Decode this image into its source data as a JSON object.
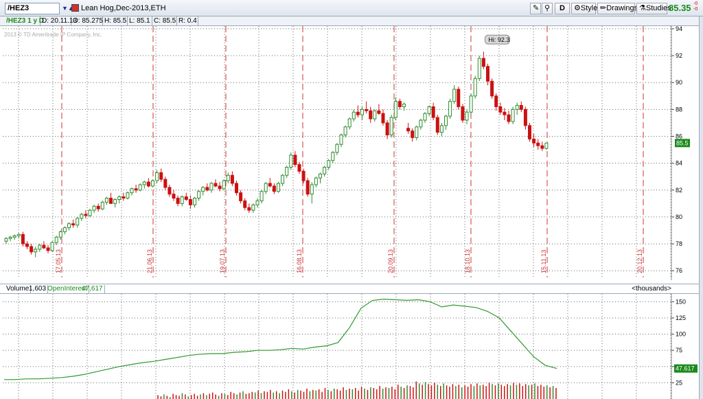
{
  "toolbar": {
    "symbol": "/HEZ3",
    "symbol_arrows": "▼▲",
    "description": "Lean Hog,Dec-2013,ETH",
    "aggregation": "D",
    "style_label": "Style",
    "drawings_label": "Drawings",
    "studies_label": "Studies",
    "last_price": "85.35",
    "net_change_top": "-0",
    "net_change_bottom": "-0"
  },
  "infobar": {
    "study": "/HEZ3 1 y D",
    "date": "D: 20.11.13",
    "open": "O: 85.275",
    "high": "H: 85.5",
    "low": "L: 85.1",
    "close": "C: 85.5",
    "range": "R: 0.4"
  },
  "price_pane": {
    "copyright": "2013 © TD Ameritrade IP Company, Inc.",
    "hi_label": "Hi: 92.3",
    "last_badge": "85.5",
    "colors": {
      "up": "#2e8b2e",
      "down": "#cc1111",
      "grid": "#666666",
      "marker": "#cc3333"
    }
  },
  "volume_header": {
    "volume_label": "Volume",
    "volume_value": "1,603",
    "oi_label": "OpenInterest",
    "oi_value": "47,617",
    "units": "<thousands>"
  },
  "volume_pane": {
    "oi_badge": "47.617"
  },
  "chart_data": {
    "type": "candlestick",
    "price_axis": {
      "ticks": [
        76,
        78,
        80,
        82,
        84,
        86,
        88,
        90,
        92,
        94
      ],
      "ylim": [
        75.5,
        94.2
      ]
    },
    "date_markers": [
      "17.05.13",
      "21.06.13",
      "19.07.13",
      "16.08.13",
      "20.09.13",
      "18.10.13",
      "15.11.13",
      "20.12.13"
    ],
    "ohlc": [
      [
        78.2,
        78.5,
        78.0,
        78.4
      ],
      [
        78.4,
        78.6,
        78.2,
        78.5
      ],
      [
        78.5,
        78.7,
        78.3,
        78.6
      ],
      [
        78.6,
        78.8,
        78.4,
        78.7
      ],
      [
        78.7,
        78.9,
        77.8,
        78.0
      ],
      [
        78.0,
        78.2,
        77.6,
        77.8
      ],
      [
        77.8,
        78.0,
        77.2,
        77.4
      ],
      [
        77.4,
        77.8,
        77.0,
        77.6
      ],
      [
        77.6,
        78.0,
        77.4,
        77.9
      ],
      [
        77.9,
        78.2,
        77.6,
        77.7
      ],
      [
        77.7,
        77.9,
        77.3,
        77.5
      ],
      [
        77.5,
        78.2,
        77.4,
        78.1
      ],
      [
        78.1,
        78.6,
        77.9,
        78.5
      ],
      [
        78.5,
        79.0,
        78.3,
        78.9
      ],
      [
        78.9,
        79.3,
        78.7,
        79.2
      ],
      [
        79.2,
        79.6,
        79.0,
        79.5
      ],
      [
        79.5,
        79.8,
        79.2,
        79.4
      ],
      [
        79.4,
        80.0,
        79.2,
        79.9
      ],
      [
        79.9,
        80.3,
        79.7,
        80.2
      ],
      [
        80.2,
        80.5,
        79.9,
        80.1
      ],
      [
        80.1,
        80.6,
        80.0,
        80.5
      ],
      [
        80.5,
        80.9,
        80.3,
        80.8
      ],
      [
        80.8,
        81.0,
        80.4,
        80.6
      ],
      [
        80.6,
        81.2,
        80.5,
        81.1
      ],
      [
        81.1,
        81.5,
        80.9,
        81.4
      ],
      [
        81.4,
        81.8,
        81.2,
        81.0
      ],
      [
        81.0,
        81.4,
        80.7,
        81.3
      ],
      [
        81.3,
        81.6,
        81.0,
        81.5
      ],
      [
        81.5,
        81.8,
        81.2,
        81.4
      ],
      [
        81.4,
        81.9,
        81.3,
        81.8
      ],
      [
        81.8,
        82.2,
        81.6,
        82.1
      ],
      [
        82.1,
        82.4,
        81.8,
        82.0
      ],
      [
        82.0,
        82.5,
        81.9,
        82.4
      ],
      [
        82.4,
        82.7,
        82.1,
        82.6
      ],
      [
        82.6,
        82.9,
        82.2,
        82.3
      ],
      [
        82.3,
        82.8,
        82.2,
        82.7
      ],
      [
        82.7,
        83.5,
        82.5,
        83.3
      ],
      [
        83.3,
        83.6,
        82.6,
        82.8
      ],
      [
        82.8,
        83.0,
        82.0,
        82.2
      ],
      [
        82.2,
        82.4,
        81.5,
        81.7
      ],
      [
        81.7,
        82.0,
        81.2,
        81.4
      ],
      [
        81.4,
        81.6,
        80.8,
        81.0
      ],
      [
        81.0,
        81.6,
        80.8,
        81.5
      ],
      [
        81.5,
        81.8,
        81.2,
        81.3
      ],
      [
        81.3,
        81.6,
        80.6,
        80.9
      ],
      [
        80.9,
        81.5,
        80.7,
        81.4
      ],
      [
        81.4,
        82.0,
        81.2,
        81.9
      ],
      [
        81.9,
        82.3,
        81.6,
        82.2
      ],
      [
        82.2,
        82.5,
        81.9,
        82.0
      ],
      [
        82.0,
        82.6,
        81.8,
        82.5
      ],
      [
        82.5,
        82.8,
        82.2,
        82.3
      ],
      [
        82.3,
        82.6,
        81.9,
        82.1
      ],
      [
        82.1,
        82.8,
        82.0,
        82.7
      ],
      [
        82.7,
        83.3,
        82.5,
        83.1
      ],
      [
        83.1,
        83.4,
        82.3,
        82.5
      ],
      [
        82.5,
        82.7,
        81.6,
        81.8
      ],
      [
        81.8,
        82.0,
        81.0,
        81.2
      ],
      [
        81.2,
        81.4,
        80.5,
        80.7
      ],
      [
        80.7,
        81.0,
        80.3,
        80.5
      ],
      [
        80.5,
        81.0,
        80.3,
        80.9
      ],
      [
        80.9,
        81.4,
        80.7,
        81.2
      ],
      [
        81.2,
        82.0,
        81.0,
        81.9
      ],
      [
        81.9,
        82.6,
        81.7,
        82.5
      ],
      [
        82.5,
        82.9,
        82.2,
        82.3
      ],
      [
        82.3,
        82.5,
        81.7,
        81.9
      ],
      [
        81.9,
        82.6,
        81.8,
        82.5
      ],
      [
        82.5,
        83.2,
        82.3,
        83.1
      ],
      [
        83.1,
        83.8,
        82.9,
        83.7
      ],
      [
        83.7,
        84.8,
        83.5,
        84.6
      ],
      [
        84.6,
        84.9,
        83.7,
        83.9
      ],
      [
        83.9,
        84.1,
        83.2,
        83.4
      ],
      [
        83.4,
        83.6,
        82.5,
        82.7
      ],
      [
        82.7,
        82.9,
        81.5,
        81.7
      ],
      [
        81.7,
        82.6,
        81.0,
        82.4
      ],
      [
        82.4,
        83.0,
        82.2,
        82.9
      ],
      [
        82.9,
        83.3,
        82.5,
        83.2
      ],
      [
        83.2,
        83.8,
        83.0,
        83.7
      ],
      [
        83.7,
        84.3,
        83.5,
        84.2
      ],
      [
        84.2,
        84.9,
        84.0,
        84.8
      ],
      [
        84.8,
        85.5,
        84.6,
        85.4
      ],
      [
        85.4,
        86.2,
        85.2,
        86.1
      ],
      [
        86.1,
        86.8,
        85.9,
        86.7
      ],
      [
        86.7,
        87.4,
        86.5,
        87.3
      ],
      [
        87.3,
        88.0,
        87.1,
        87.8
      ],
      [
        87.8,
        88.3,
        87.4,
        87.6
      ],
      [
        87.6,
        88.2,
        87.2,
        88.0
      ],
      [
        88.0,
        88.6,
        87.7,
        87.9
      ],
      [
        87.9,
        88.2,
        87.0,
        87.3
      ],
      [
        87.3,
        88.0,
        87.1,
        87.9
      ],
      [
        87.9,
        88.4,
        87.6,
        87.7
      ],
      [
        87.7,
        88.0,
        86.8,
        87.0
      ],
      [
        87.0,
        87.2,
        85.8,
        86.1
      ],
      [
        86.1,
        87.6,
        85.9,
        87.4
      ],
      [
        87.4,
        88.9,
        87.2,
        88.6
      ],
      [
        88.6,
        88.8,
        88.0,
        88.2
      ],
      [
        88.2,
        88.5,
        87.9,
        88.4
      ],
      [
        86.6,
        87.0,
        86.2,
        86.4
      ],
      [
        86.4,
        86.6,
        85.6,
        85.9
      ],
      [
        85.9,
        86.8,
        85.7,
        86.7
      ],
      [
        86.7,
        87.3,
        86.5,
        87.2
      ],
      [
        87.2,
        87.8,
        87.0,
        87.7
      ],
      [
        87.7,
        88.3,
        87.5,
        88.2
      ],
      [
        88.2,
        88.5,
        87.2,
        87.4
      ],
      [
        87.4,
        87.6,
        86.1,
        86.3
      ],
      [
        86.3,
        87.0,
        86.0,
        86.8
      ],
      [
        86.8,
        87.6,
        86.5,
        87.5
      ],
      [
        87.5,
        88.8,
        87.3,
        88.6
      ],
      [
        88.6,
        89.8,
        88.4,
        89.5
      ],
      [
        89.5,
        89.7,
        88.0,
        88.2
      ],
      [
        88.2,
        88.4,
        87.0,
        87.2
      ],
      [
        87.2,
        88.0,
        86.9,
        87.8
      ],
      [
        87.8,
        89.2,
        87.6,
        89.0
      ],
      [
        89.0,
        90.5,
        88.8,
        90.3
      ],
      [
        90.3,
        92.0,
        90.1,
        91.8
      ],
      [
        91.8,
        92.3,
        91.0,
        91.2
      ],
      [
        91.2,
        91.4,
        89.8,
        90.1
      ],
      [
        90.1,
        90.3,
        88.8,
        89.0
      ],
      [
        89.0,
        89.2,
        87.9,
        88.2
      ],
      [
        88.2,
        88.5,
        87.6,
        87.8
      ],
      [
        87.8,
        88.1,
        87.2,
        87.6
      ],
      [
        87.6,
        87.9,
        86.9,
        87.1
      ],
      [
        87.1,
        88.2,
        86.9,
        88.0
      ],
      [
        88.0,
        88.5,
        87.6,
        88.3
      ],
      [
        88.3,
        88.6,
        87.8,
        88.0
      ],
      [
        88.0,
        88.2,
        86.5,
        86.8
      ],
      [
        86.8,
        87.0,
        85.6,
        85.8
      ],
      [
        85.8,
        86.2,
        85.2,
        85.5
      ],
      [
        85.5,
        85.8,
        85.0,
        85.3
      ],
      [
        85.3,
        85.6,
        84.9,
        85.1
      ],
      [
        85.1,
        85.5,
        85.0,
        85.5
      ]
    ],
    "open_interest": [
      30,
      30,
      31,
      31,
      32,
      33,
      35,
      38,
      42,
      46,
      50,
      53,
      56,
      58,
      61,
      64,
      67,
      69,
      70,
      70,
      72,
      73,
      75,
      75,
      76,
      78,
      77,
      80,
      82,
      87,
      110,
      140,
      152,
      154,
      153,
      152,
      153,
      150,
      142,
      145,
      143,
      141,
      135,
      125,
      105,
      85,
      65,
      52,
      47
    ],
    "oi_axis": {
      "ticks": [
        25,
        50,
        75,
        100,
        125,
        150
      ],
      "ylim": [
        0,
        162
      ]
    },
    "volume": [
      6,
      4,
      7,
      5,
      3,
      8,
      6,
      5,
      9,
      7,
      4,
      6,
      8,
      5,
      7,
      9,
      6,
      8,
      10,
      7,
      5,
      9,
      8,
      6,
      11,
      9,
      7,
      10,
      12,
      8,
      9,
      11,
      10,
      13,
      9,
      12,
      11,
      14,
      10,
      12,
      9,
      13,
      11,
      15,
      12,
      10,
      14,
      13,
      11,
      16,
      12,
      14,
      13,
      15,
      11,
      17,
      14,
      12,
      16,
      15,
      13,
      18,
      14,
      16,
      15,
      17,
      13,
      19,
      16,
      14,
      18,
      17,
      15,
      20,
      16,
      18,
      17,
      19,
      15,
      22,
      19,
      17,
      21,
      20,
      18,
      27,
      24,
      22,
      26,
      23,
      21,
      25,
      22,
      20,
      24,
      21,
      19,
      23,
      20,
      22,
      18,
      21,
      19,
      23,
      20,
      24,
      21,
      22,
      20,
      25,
      23,
      21,
      24,
      22,
      20,
      23,
      21,
      25,
      22,
      24,
      20,
      23,
      21,
      22,
      24,
      20,
      22,
      19,
      21,
      18,
      20,
      17
    ]
  }
}
